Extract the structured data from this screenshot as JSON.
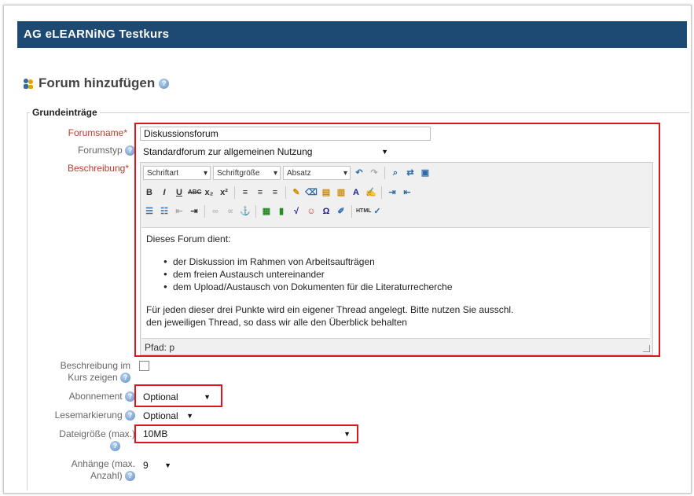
{
  "course_title": "AG eLEARNiNG Testkurs",
  "page_title": "Forum hinzufügen",
  "fieldset_legend": "Grundeinträge",
  "fields": {
    "forumsname": {
      "label": "Forumsname",
      "value": "Diskussionsforum"
    },
    "forumstyp": {
      "label": "Forumstyp",
      "value": "Standardforum zur allgemeinen Nutzung"
    },
    "beschreibung": {
      "label": "Beschreibung"
    },
    "beschreibung_zeigen": {
      "label_line1": "Beschreibung im",
      "label_line2": "Kurs zeigen"
    },
    "abonnement": {
      "label": "Abonnement",
      "value": "Optional"
    },
    "lesemarkierung": {
      "label": "Lesemarkierung",
      "value": "Optional"
    },
    "dateigroesse": {
      "label": "Dateigröße (max.)",
      "value": "10MB"
    },
    "anhaenge": {
      "label_line1": "Anhänge (max.",
      "label_line2": "Anzahl)",
      "value": "9"
    }
  },
  "editor": {
    "font_family_label": "Schriftart",
    "font_size_label": "Schriftgröße",
    "format_label": "Absatz",
    "intro": "Dieses Forum dient:",
    "bullets": [
      "der Diskussion im Rahmen von Arbeitsaufträgen",
      "dem freien Austausch untereinander",
      "dem Upload/Austausch von Dokumenten für die Literaturrecherche"
    ],
    "closing_line1": "Für jeden dieser drei Punkte wird ein eigener Thread angelegt. Bitte nutzen Sie ausschl.",
    "closing_line2": "den jeweiligen Thread, so dass wir alle den Überblick behalten",
    "path": "Pfad: p"
  },
  "colors": {
    "header_bg": "#1d4a73",
    "required": "#c0392b",
    "highlight_box": "#e0141e"
  }
}
